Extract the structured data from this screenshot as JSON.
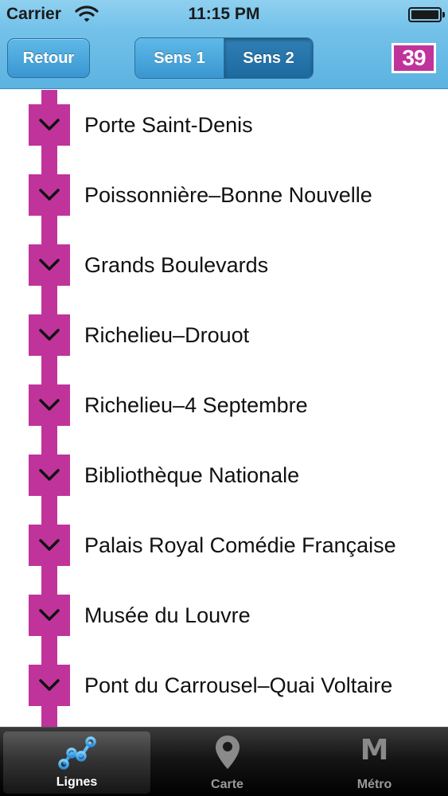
{
  "status_bar": {
    "carrier": "Carrier",
    "time": "11:15 PM"
  },
  "nav": {
    "back_label": "Retour",
    "segments": [
      {
        "label": "Sens 1",
        "selected": false
      },
      {
        "label": "Sens 2",
        "selected": true
      }
    ],
    "line_number": "39"
  },
  "colors": {
    "line": "#c0339b",
    "nav_blue": "#5bb2e0"
  },
  "stations": [
    {
      "name": "Porte Saint-Denis"
    },
    {
      "name": "Poissonnière–Bonne Nouvelle"
    },
    {
      "name": "Grands Boulevards"
    },
    {
      "name": "Richelieu–Drouot"
    },
    {
      "name": "Richelieu–4 Septembre"
    },
    {
      "name": "Bibliothèque Nationale"
    },
    {
      "name": "Palais Royal Comédie Française"
    },
    {
      "name": "Musée du Louvre"
    },
    {
      "name": "Pont du Carrousel–Quai Voltaire"
    }
  ],
  "tab_bar": {
    "tabs": [
      {
        "label": "Lignes",
        "icon": "lines-icon",
        "active": true
      },
      {
        "label": "Carte",
        "icon": "map-pin-icon",
        "active": false
      },
      {
        "label": "Métro",
        "icon": "metro-icon",
        "icon_glyph": "M",
        "active": false
      }
    ]
  }
}
